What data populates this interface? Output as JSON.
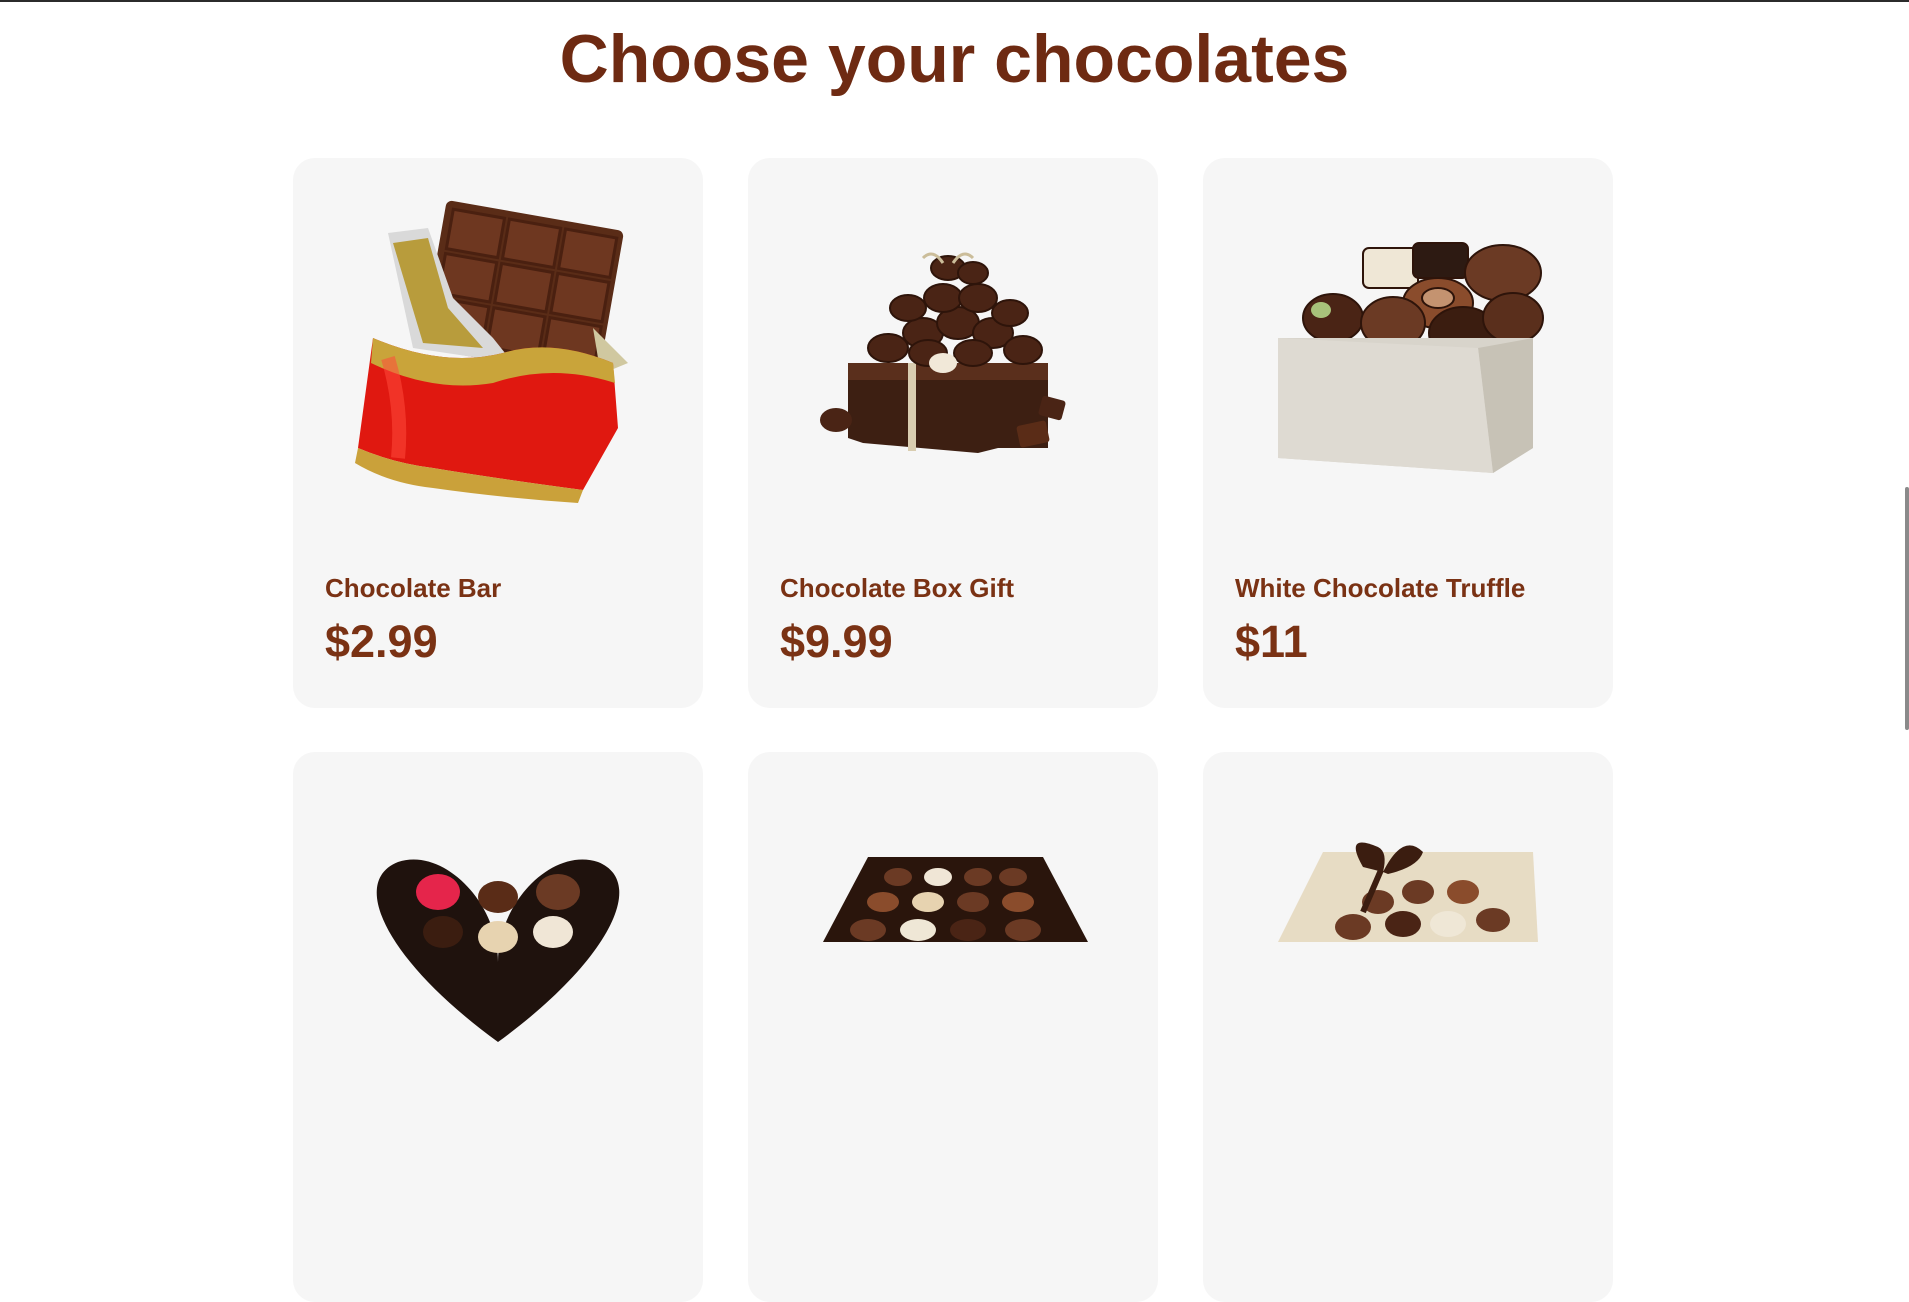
{
  "page": {
    "title": "Choose your chocolates"
  },
  "products": [
    {
      "name": "Chocolate Bar",
      "price": "$2.99",
      "image_icon": "chocolate-bar-image"
    },
    {
      "name": "Chocolate Box Gift",
      "price": "$9.99",
      "image_icon": "chocolate-box-gift-image"
    },
    {
      "name": "White Chocolate Truffle",
      "price": "$11",
      "image_icon": "white-chocolate-truffle-image"
    },
    {
      "name": "",
      "price": "",
      "image_icon": "heart-chocolate-box-image"
    },
    {
      "name": "",
      "price": "",
      "image_icon": "square-chocolate-assortment-image"
    },
    {
      "name": "",
      "price": "",
      "image_icon": "ribbon-chocolate-box-image"
    }
  ],
  "colors": {
    "title": "#6e2a12",
    "text": "#7a3214",
    "card_bg": "#f6f6f6"
  }
}
